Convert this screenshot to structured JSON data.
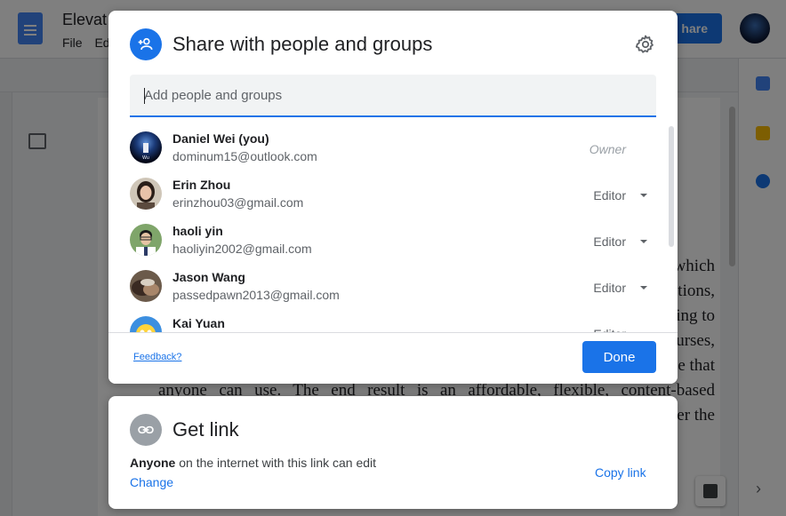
{
  "background": {
    "doc_title": "Elevat",
    "menu_file": "File",
    "menu_edit": "Ed",
    "share_label": "hare",
    "doc_lines": [
      "which",
      "ations,",
      "ing to",
      "urses,",
      "e that",
      "anyone  can  use.  The  end  result  is  an  affordable,  flexible,  content-based",
      "er the"
    ]
  },
  "share_dialog": {
    "title": "Share with people and groups",
    "header_icon": "person-add-icon",
    "settings_icon": "gear-icon",
    "add_people_placeholder": "Add people and groups",
    "people": [
      {
        "name": "Daniel Wei (you)",
        "email": "dominum15@outlook.com",
        "role": "Owner"
      },
      {
        "name": "Erin Zhou",
        "email": "erinzhou03@gmail.com",
        "role": "Editor"
      },
      {
        "name": "haoli yin",
        "email": "haoliyin2002@gmail.com",
        "role": "Editor"
      },
      {
        "name": "Jason Wang",
        "email": "passedpawn2013@gmail.com",
        "role": "Editor"
      },
      {
        "name": "Kai Yuan",
        "email": "",
        "role": "Editor"
      }
    ],
    "feedback_label": "Feedback?",
    "done_label": "Done"
  },
  "link_dialog": {
    "title": "Get link",
    "icon": "link-icon",
    "description_bold": "Anyone",
    "description_rest": " on the internet with this link can edit",
    "change_label": "Change",
    "copy_link_label": "Copy link"
  },
  "colors": {
    "accent": "#1a73e8",
    "overlay": "rgba(0,0,0,0.5)",
    "text_primary": "#202124",
    "text_secondary": "#5f6368"
  }
}
